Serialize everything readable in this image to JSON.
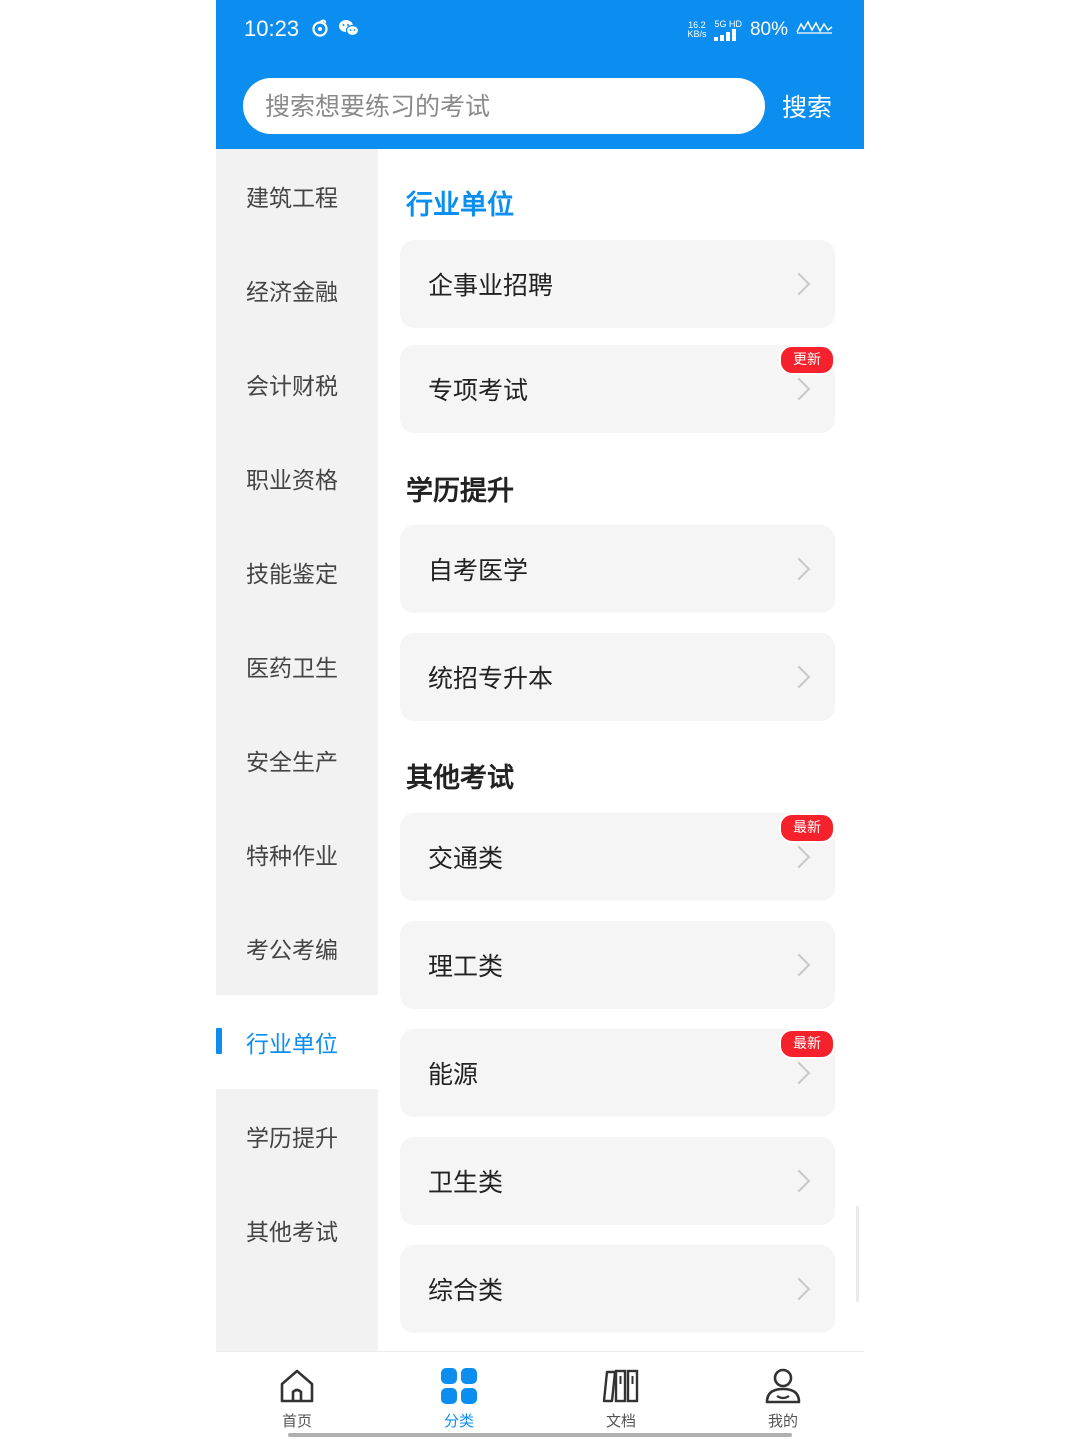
{
  "status_bar": {
    "time": "10:23",
    "net_speed_value": "16.2",
    "net_speed_unit": "KB/s",
    "signal_label": "5G HD",
    "battery": "80%"
  },
  "search": {
    "placeholder": "搜索想要练习的考试",
    "button_label": "搜索"
  },
  "sidebar": {
    "items": [
      {
        "label": "建筑工程"
      },
      {
        "label": "经济金融"
      },
      {
        "label": "会计财税"
      },
      {
        "label": "职业资格"
      },
      {
        "label": "技能鉴定"
      },
      {
        "label": "医药卫生"
      },
      {
        "label": "安全生产"
      },
      {
        "label": "特种作业"
      },
      {
        "label": "考公考编"
      },
      {
        "label": "行业单位"
      },
      {
        "label": "学历提升"
      },
      {
        "label": "其他考试"
      }
    ],
    "active_index": 9
  },
  "sections": [
    {
      "title": "行业单位",
      "items": [
        {
          "label": "企事业招聘",
          "badge": ""
        },
        {
          "label": "专项考试",
          "badge": "更新"
        }
      ]
    },
    {
      "title": "学历提升",
      "items": [
        {
          "label": "自考医学",
          "badge": ""
        },
        {
          "label": "统招专升本",
          "badge": ""
        }
      ]
    },
    {
      "title": "其他考试",
      "items": [
        {
          "label": "交通类",
          "badge": "最新"
        },
        {
          "label": "理工类",
          "badge": ""
        },
        {
          "label": "能源",
          "badge": "最新"
        },
        {
          "label": "卫生类",
          "badge": ""
        },
        {
          "label": "综合类",
          "badge": ""
        }
      ]
    }
  ],
  "tabbar": {
    "tabs": [
      {
        "label": "首页",
        "icon": "home-icon"
      },
      {
        "label": "分类",
        "icon": "category-grid-icon"
      },
      {
        "label": "文档",
        "icon": "documents-icon"
      },
      {
        "label": "我的",
        "icon": "profile-icon"
      }
    ],
    "active_index": 1
  },
  "colors": {
    "primary": "#0b8ef0",
    "badge": "#f5222d",
    "sidebar_bg": "#f2f2f2",
    "card_bg": "#f5f5f5"
  }
}
